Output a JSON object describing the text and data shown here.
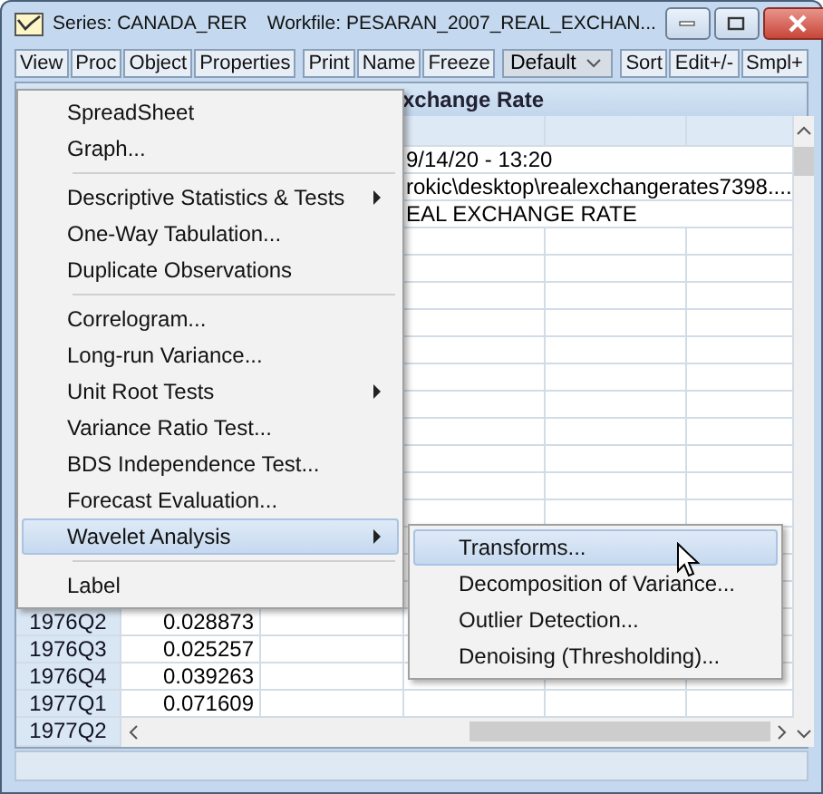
{
  "window": {
    "title": "Series: CANADA_RER",
    "workfile": "Workfile: PESARAN_2007_REAL_EXCHAN..."
  },
  "toolbar": {
    "groups": [
      {
        "buttons": [
          "View",
          "Proc",
          "Object",
          "Properties"
        ]
      },
      {
        "buttons": [
          "Print",
          "Name",
          "Freeze"
        ]
      }
    ],
    "dropdown": "Default",
    "buttons_right": [
      "Sort",
      "Edit+/-",
      "Smpl+"
    ]
  },
  "sheet": {
    "title": "xchange Rate",
    "info_rows": [
      "9/14/20 - 13:20",
      "rokic\\desktop\\realexchangerates7398....",
      "EAL EXCHANGE RATE"
    ],
    "rows": [
      {
        "label": "1976Q2",
        "value": "0.028873"
      },
      {
        "label": "1976Q3",
        "value": "0.025257"
      },
      {
        "label": "1976Q4",
        "value": "0.039263"
      },
      {
        "label": "1977Q1",
        "value": "0.071609"
      }
    ],
    "last_row_label": "1977Q2"
  },
  "menu": {
    "groups": [
      {
        "items": [
          {
            "label": "SpreadSheet",
            "submenu": false,
            "selected": false
          },
          {
            "label": "Graph...",
            "submenu": false,
            "selected": false
          }
        ]
      },
      {
        "items": [
          {
            "label": "Descriptive Statistics & Tests",
            "submenu": true,
            "selected": false
          },
          {
            "label": "One-Way Tabulation...",
            "submenu": false,
            "selected": false
          },
          {
            "label": "Duplicate Observations",
            "submenu": false,
            "selected": false
          }
        ]
      },
      {
        "items": [
          {
            "label": "Correlogram...",
            "submenu": false,
            "selected": false
          },
          {
            "label": "Long-run Variance...",
            "submenu": false,
            "selected": false
          },
          {
            "label": "Unit Root Tests",
            "submenu": true,
            "selected": false
          },
          {
            "label": "Variance Ratio Test...",
            "submenu": false,
            "selected": false
          },
          {
            "label": "BDS Independence Test...",
            "submenu": false,
            "selected": false
          },
          {
            "label": "Forecast Evaluation...",
            "submenu": false,
            "selected": false
          },
          {
            "label": "Wavelet Analysis",
            "submenu": true,
            "selected": true
          }
        ]
      },
      {
        "items": [
          {
            "label": "Label",
            "submenu": false,
            "selected": false
          }
        ]
      }
    ]
  },
  "submenu": {
    "items": [
      {
        "label": "Transforms...",
        "selected": true
      },
      {
        "label": "Decomposition of Variance...",
        "selected": false
      },
      {
        "label": "Outlier Detection...",
        "selected": false
      },
      {
        "label": "Denoising (Thresholding)...",
        "selected": false
      }
    ]
  }
}
